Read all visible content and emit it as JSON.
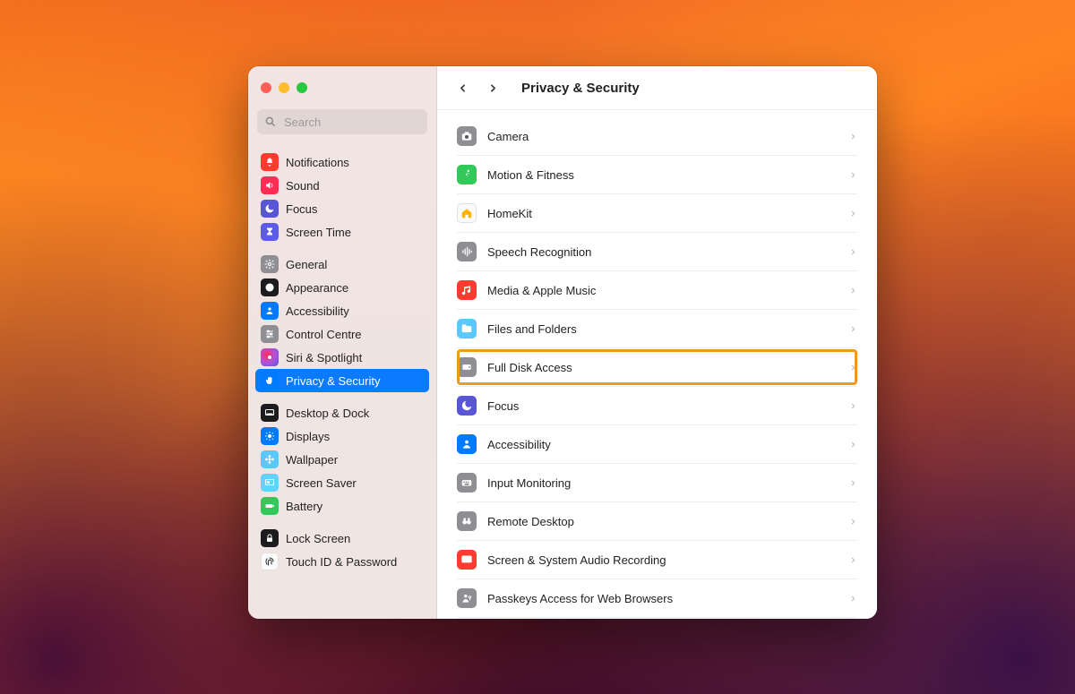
{
  "header": {
    "title": "Privacy & Security"
  },
  "search": {
    "placeholder": "Search"
  },
  "sidebar": {
    "groups": [
      [
        {
          "label": "Notifications",
          "icon": "bell",
          "bg": "ic-red"
        },
        {
          "label": "Sound",
          "icon": "speaker",
          "bg": "ic-pink"
        },
        {
          "label": "Focus",
          "icon": "moon",
          "bg": "ic-indigo"
        },
        {
          "label": "Screen Time",
          "icon": "hourglass",
          "bg": "ic-purple"
        }
      ],
      [
        {
          "label": "General",
          "icon": "gear",
          "bg": "ic-gray"
        },
        {
          "label": "Appearance",
          "icon": "contrast",
          "bg": "ic-black"
        },
        {
          "label": "Accessibility",
          "icon": "person",
          "bg": "ic-blue"
        },
        {
          "label": "Control Centre",
          "icon": "sliders",
          "bg": "ic-gray"
        },
        {
          "label": "Siri & Spotlight",
          "icon": "siri",
          "bg": "ic-siri"
        },
        {
          "label": "Privacy & Security",
          "icon": "hand",
          "bg": "ic-blue",
          "selected": true
        }
      ],
      [
        {
          "label": "Desktop & Dock",
          "icon": "dock",
          "bg": "ic-black"
        },
        {
          "label": "Displays",
          "icon": "sun",
          "bg": "ic-blue"
        },
        {
          "label": "Wallpaper",
          "icon": "flower",
          "bg": "ic-teal"
        },
        {
          "label": "Screen Saver",
          "icon": "screensave",
          "bg": "ic-cyan"
        },
        {
          "label": "Battery",
          "icon": "battery",
          "bg": "ic-green"
        }
      ],
      [
        {
          "label": "Lock Screen",
          "icon": "lock",
          "bg": "ic-black"
        },
        {
          "label": "Touch ID & Password",
          "icon": "fingerprint",
          "bg": "ic-white"
        }
      ]
    ]
  },
  "main": {
    "rows": [
      {
        "label": "Camera",
        "icon": "camera",
        "bg": "ic-gray"
      },
      {
        "label": "Motion & Fitness",
        "icon": "runner",
        "bg": "ic-green"
      },
      {
        "label": "HomeKit",
        "icon": "house",
        "bg": "ic-white",
        "fg": "#ffb300"
      },
      {
        "label": "Speech Recognition",
        "icon": "waveform",
        "bg": "ic-gray"
      },
      {
        "label": "Media & Apple Music",
        "icon": "music",
        "bg": "ic-red"
      },
      {
        "label": "Files and Folders",
        "icon": "folder",
        "bg": "ic-teal"
      },
      {
        "label": "Full Disk Access",
        "icon": "disk",
        "bg": "ic-gray",
        "highlight": true
      },
      {
        "label": "Focus",
        "icon": "moon",
        "bg": "ic-indigo"
      },
      {
        "label": "Accessibility",
        "icon": "person",
        "bg": "ic-blue"
      },
      {
        "label": "Input Monitoring",
        "icon": "keyboard",
        "bg": "ic-gray"
      },
      {
        "label": "Remote Desktop",
        "icon": "binoculars",
        "bg": "ic-gray"
      },
      {
        "label": "Screen & System Audio Recording",
        "icon": "record",
        "bg": "ic-red"
      },
      {
        "label": "Passkeys Access for Web Browsers",
        "icon": "personkey",
        "bg": "ic-gray"
      }
    ]
  }
}
